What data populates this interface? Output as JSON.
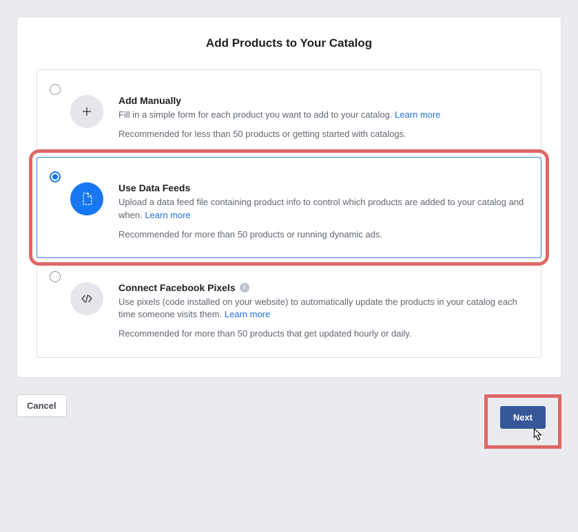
{
  "page_title": "Add Products to Your Catalog",
  "options": [
    {
      "title": "Add Manually",
      "description": "Fill in a simple form for each product you want to add to your catalog. ",
      "learn_more": "Learn more",
      "recommended": "Recommended for less than 50 products or getting started with catalogs.",
      "selected": false,
      "icon": "plus-icon",
      "has_info": false
    },
    {
      "title": "Use Data Feeds",
      "description": "Upload a data feed file containing product info to control which products are added to your catalog and when. ",
      "learn_more": "Learn more",
      "recommended": "Recommended for more than 50 products or running dynamic ads.",
      "selected": true,
      "icon": "file-icon",
      "has_info": false
    },
    {
      "title": "Connect Facebook Pixels",
      "description": "Use pixels (code installed on your website) to automatically update the products in your catalog each time someone visits them. ",
      "learn_more": "Learn more",
      "recommended": "Recommended for more than 50 products that get updated hourly or daily.",
      "selected": false,
      "icon": "code-icon",
      "has_info": true
    }
  ],
  "buttons": {
    "cancel": "Cancel",
    "next": "Next"
  }
}
